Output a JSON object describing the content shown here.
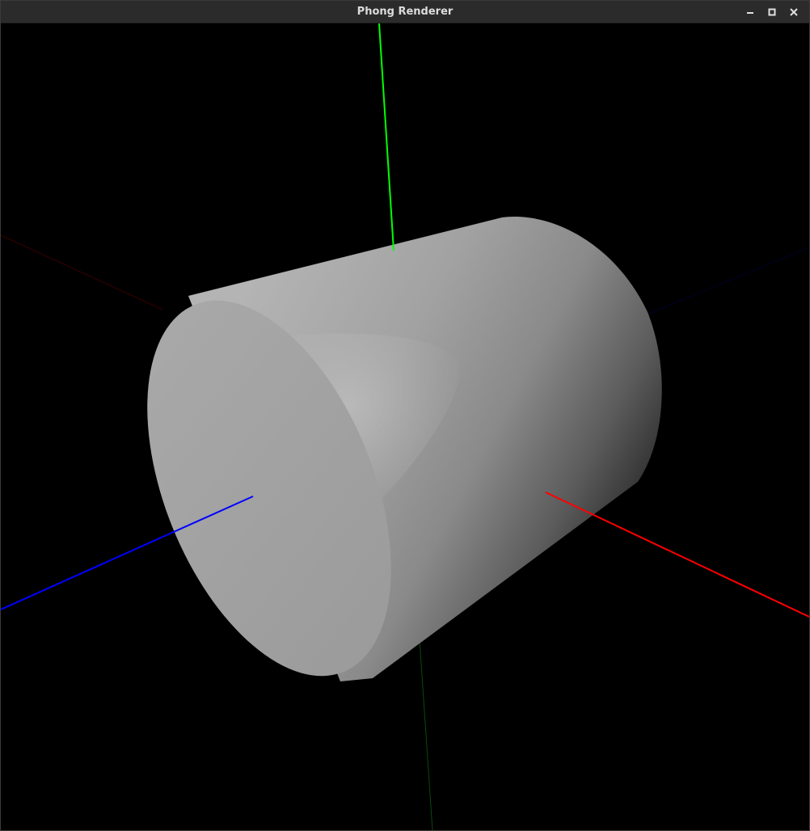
{
  "window": {
    "title": "Phong Renderer",
    "buttons": [
      "minimize",
      "maximize",
      "close"
    ]
  },
  "scene": {
    "background": "#000000",
    "object": "cylinder",
    "shading": "phong",
    "axes": {
      "x": "#ff0000",
      "y": "#00ff00",
      "z": "#0000ff"
    }
  },
  "icons": {
    "minimize": "minimize-icon",
    "maximize": "maximize-icon",
    "close": "close-icon"
  }
}
